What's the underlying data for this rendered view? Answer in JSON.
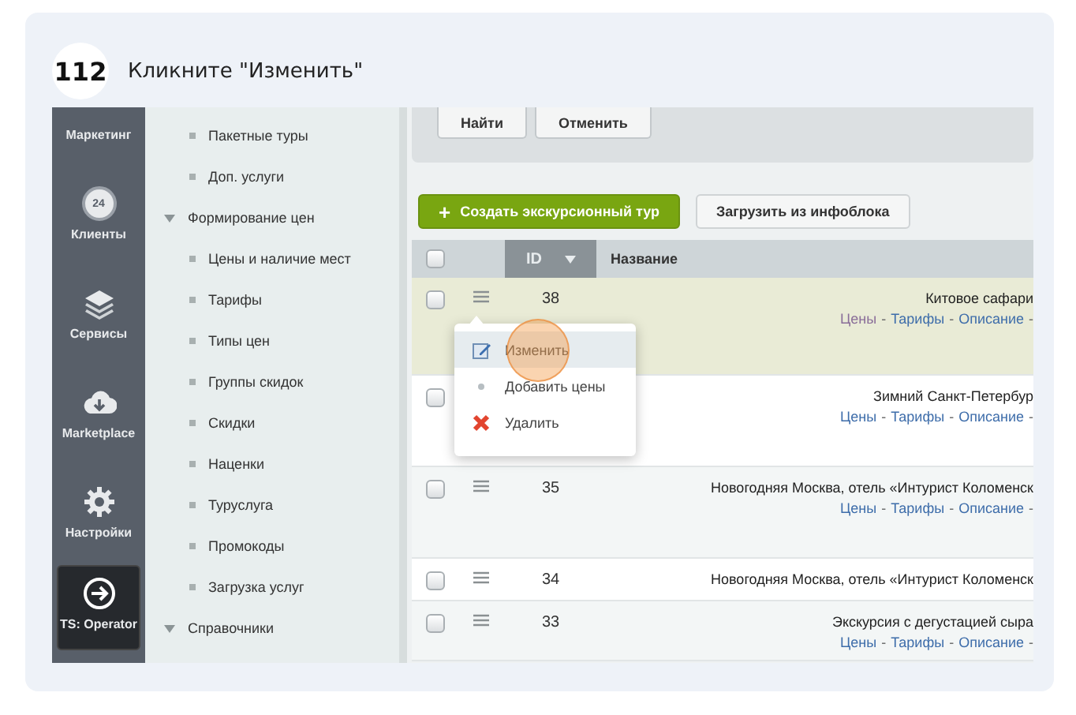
{
  "step": {
    "number": "112",
    "instruction": "Кликните \"Изменить\""
  },
  "rail": [
    {
      "label": "Маркетинг",
      "kind": "none",
      "selected": false
    },
    {
      "label": "Клиенты",
      "kind": "clock",
      "icon_text": "24",
      "selected": false
    },
    {
      "label": "Сервисы",
      "kind": "layers",
      "selected": false
    },
    {
      "label": "Marketplace",
      "kind": "cloud",
      "selected": false
    },
    {
      "label": "Настройки",
      "kind": "gear",
      "selected": false
    },
    {
      "label": "TS: Operator",
      "kind": "arrow",
      "selected": true
    }
  ],
  "menu": [
    {
      "label": "Пакетные туры",
      "kind": "leaf"
    },
    {
      "label": "Доп. услуги",
      "kind": "leaf"
    },
    {
      "label": "Формирование цен",
      "kind": "section"
    },
    {
      "label": "Цены и наличие мест",
      "kind": "leaf"
    },
    {
      "label": "Тарифы",
      "kind": "leaf"
    },
    {
      "label": "Типы цен",
      "kind": "leaf"
    },
    {
      "label": "Группы скидок",
      "kind": "leaf"
    },
    {
      "label": "Скидки",
      "kind": "leaf"
    },
    {
      "label": "Наценки",
      "kind": "leaf"
    },
    {
      "label": "Туруслуга",
      "kind": "leaf"
    },
    {
      "label": "Промокоды",
      "kind": "leaf"
    },
    {
      "label": "Загрузка услуг",
      "kind": "leaf"
    },
    {
      "label": "Справочники",
      "kind": "section"
    }
  ],
  "filter_buttons": [
    "Найти",
    "Отменить"
  ],
  "toolbar": [
    {
      "label": "Создать экскурсионный тур",
      "kind": "primary",
      "icon_text": "+"
    },
    {
      "label": "Загрузить из инфоблока",
      "kind": "secondary"
    }
  ],
  "table": {
    "header_checked": false,
    "columns": [
      {
        "label": "ID",
        "sorted": true
      },
      {
        "label": "Название",
        "sorted": false
      }
    ],
    "rows": [
      {
        "id": "38",
        "name": "Китовое сафари",
        "checked": false,
        "highlighted": true,
        "links": [
          {
            "kind": "link",
            "text": "Цены",
            "visited": true
          },
          {
            "kind": "sep",
            "text": "-"
          },
          {
            "kind": "link",
            "text": "Тарифы",
            "visited": false
          },
          {
            "kind": "sep",
            "text": "-"
          },
          {
            "kind": "link",
            "text": "Описание",
            "visited": false
          },
          {
            "kind": "sep",
            "text": "-"
          }
        ]
      },
      {
        "id": "",
        "name": "Зимний Санкт-Петербур",
        "checked": false,
        "highlighted": false,
        "links": [
          {
            "kind": "link",
            "text": "Цены",
            "visited": false
          },
          {
            "kind": "sep",
            "text": "-"
          },
          {
            "kind": "link",
            "text": "Тарифы",
            "visited": false
          },
          {
            "kind": "sep",
            "text": "-"
          },
          {
            "kind": "link",
            "text": "Описание",
            "visited": false
          },
          {
            "kind": "sep",
            "text": "-"
          }
        ]
      },
      {
        "id": "35",
        "name": "Новогодняя Москва, отель «Интурист Коломенск",
        "checked": false,
        "highlighted": false,
        "links": [
          {
            "kind": "link",
            "text": "Цены",
            "visited": false
          },
          {
            "kind": "sep",
            "text": "-"
          },
          {
            "kind": "link",
            "text": "Тарифы",
            "visited": false
          },
          {
            "kind": "sep",
            "text": "-"
          },
          {
            "kind": "link",
            "text": "Описание",
            "visited": false
          },
          {
            "kind": "sep",
            "text": "-"
          }
        ]
      },
      {
        "id": "34",
        "name": "Новогодняя Москва, отель «Интурист Коломенск",
        "checked": false,
        "highlighted": false,
        "links": []
      },
      {
        "id": "33",
        "name": "Экскурсия с дегустацией сыра",
        "checked": false,
        "highlighted": false,
        "links": [
          {
            "kind": "link",
            "text": "Цены",
            "visited": false
          },
          {
            "kind": "sep",
            "text": "-"
          },
          {
            "kind": "link",
            "text": "Тарифы",
            "visited": false
          },
          {
            "kind": "sep",
            "text": "-"
          },
          {
            "kind": "link",
            "text": "Описание",
            "visited": false
          },
          {
            "kind": "sep",
            "text": "-"
          }
        ]
      }
    ]
  },
  "context_menu": {
    "items": [
      {
        "label": "Изменить",
        "kind": "edit",
        "hovered": true
      },
      {
        "label": "Добавить цены",
        "kind": "dot",
        "hovered": false
      },
      {
        "label": "Удалить",
        "kind": "delete",
        "hovered": false
      }
    ]
  },
  "click_marker": true
}
